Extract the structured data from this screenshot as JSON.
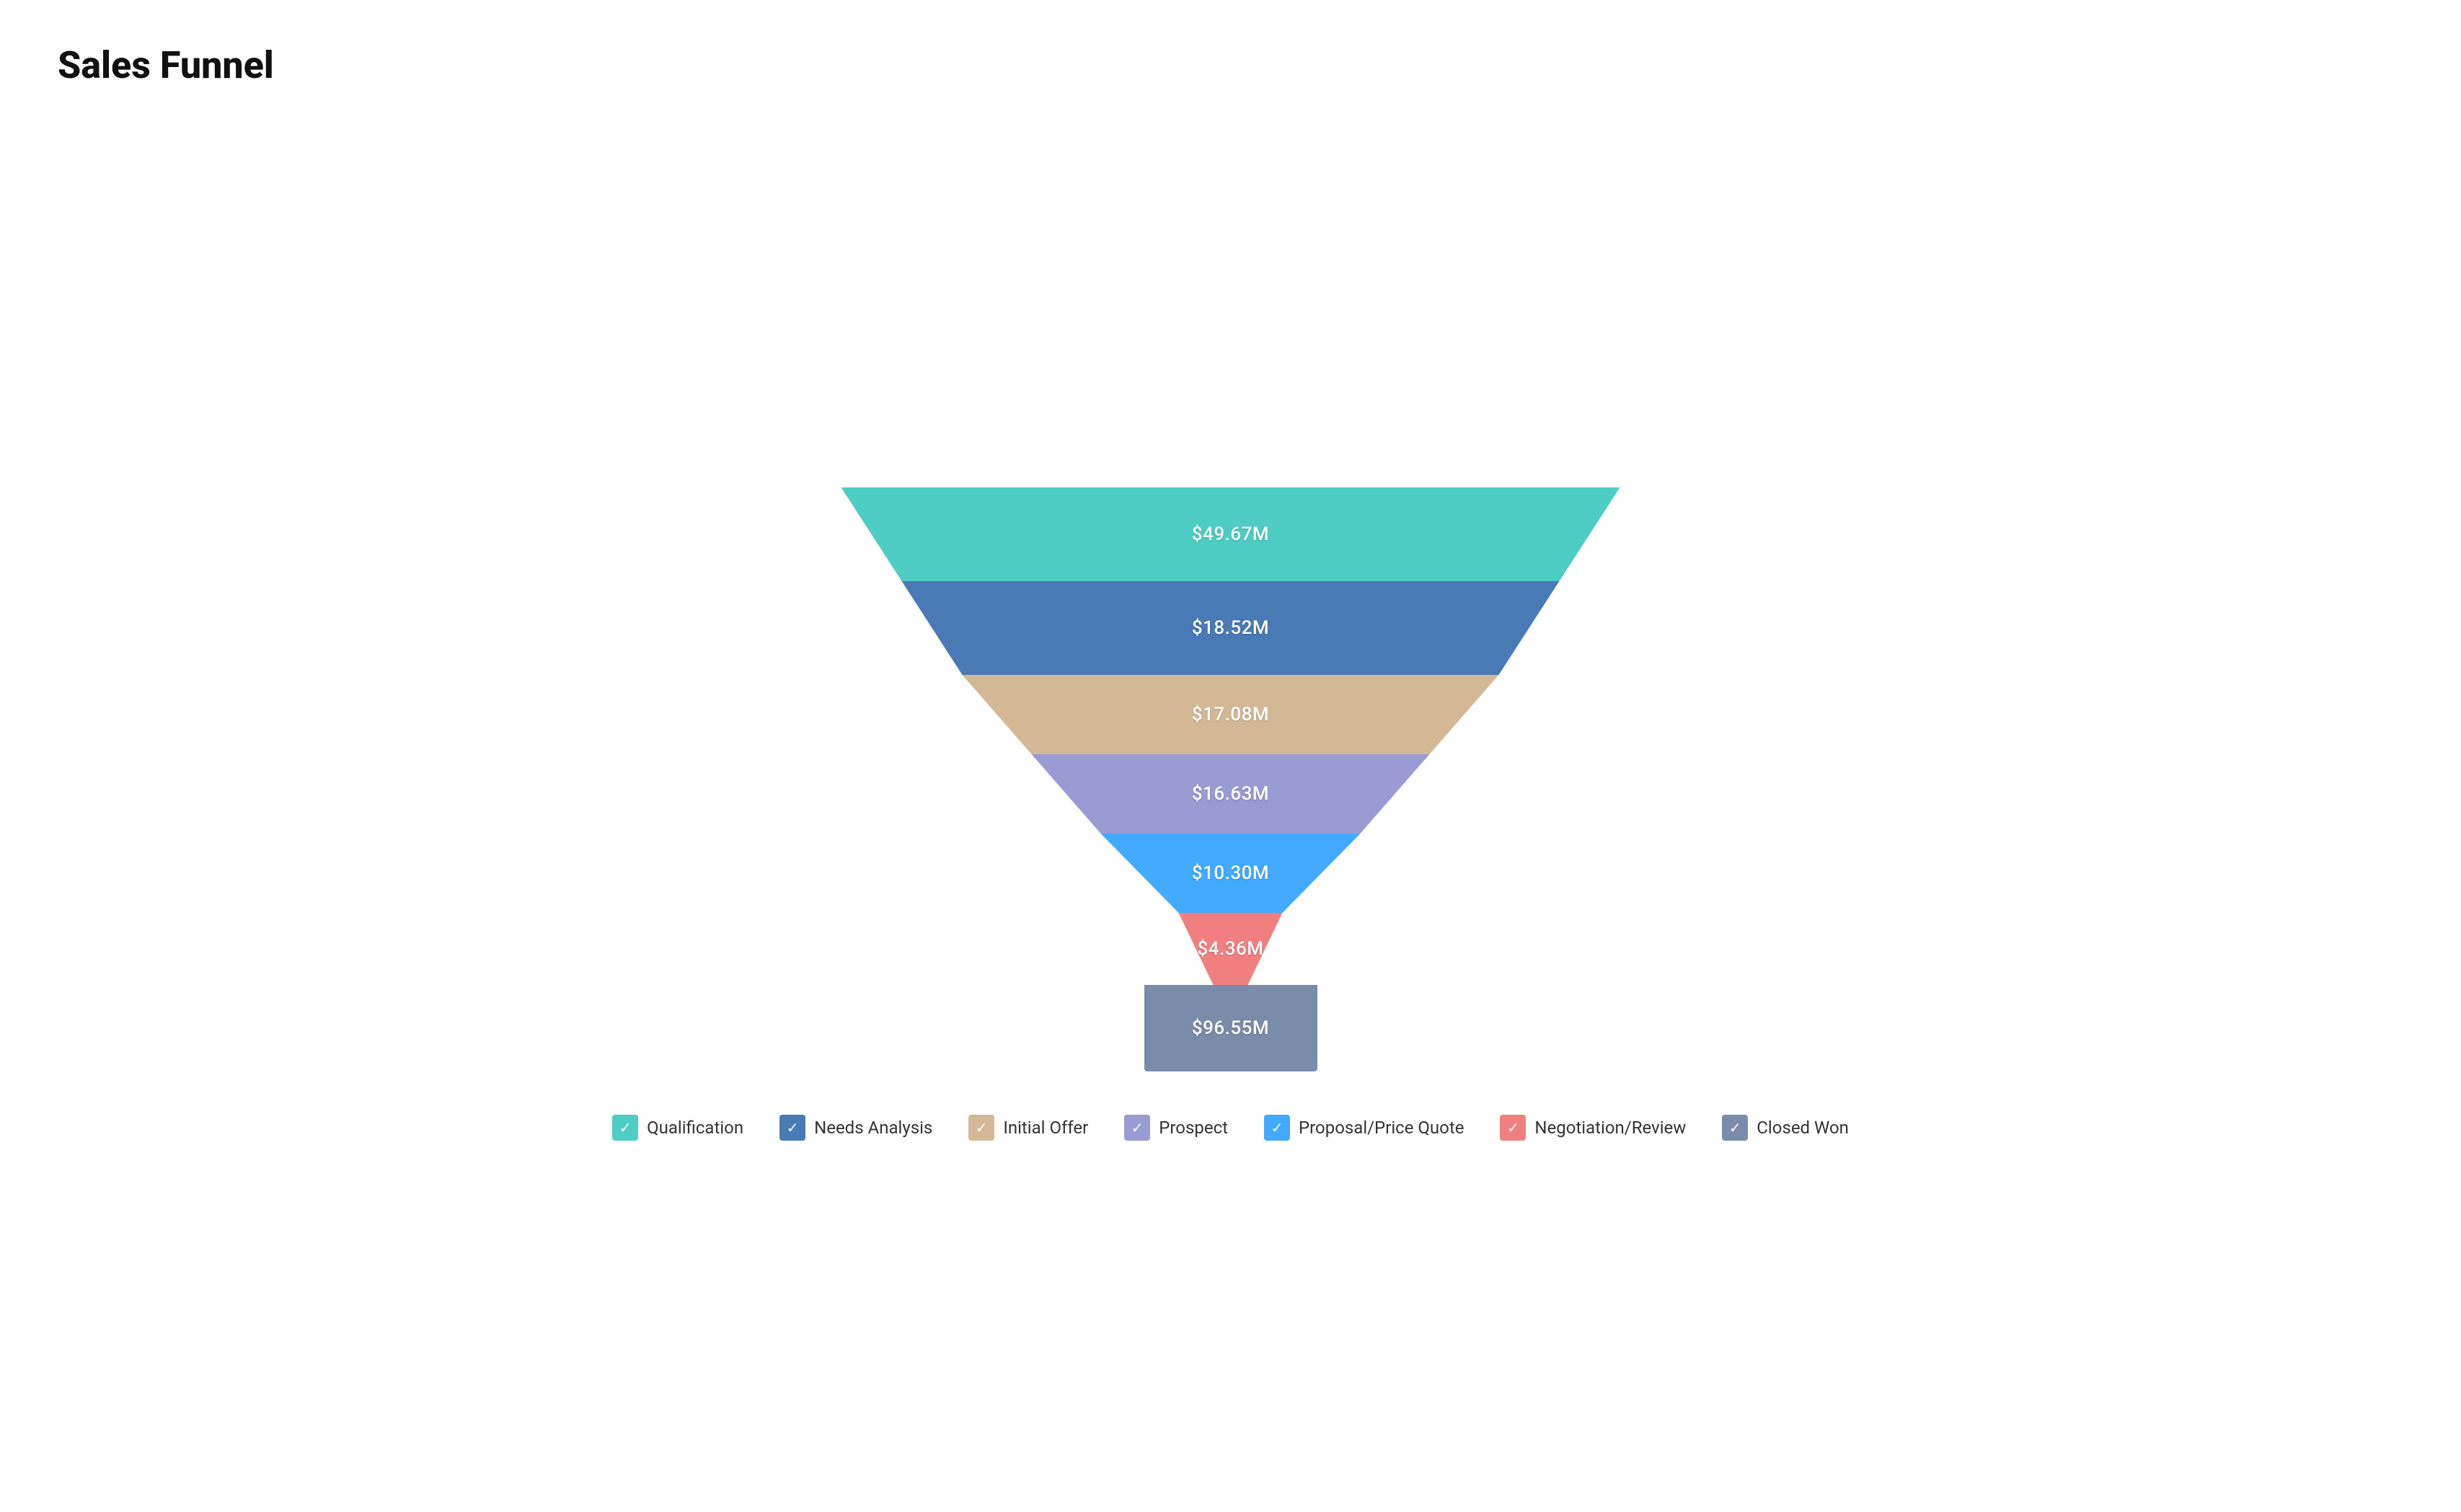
{
  "title": "Sales Funnel",
  "segments": [
    {
      "id": "qualification",
      "label": "$49.67M",
      "color": "#4ecdc4",
      "legend": "Qualification"
    },
    {
      "id": "needs-analysis",
      "label": "$18.52M",
      "color": "#4a7ab5",
      "legend": "Needs Analysis"
    },
    {
      "id": "initial-offer",
      "label": "$17.08M",
      "color": "#d4b896",
      "legend": "Initial Offer"
    },
    {
      "id": "prospect",
      "label": "$16.63M",
      "color": "#9b9bd4",
      "legend": "Prospect"
    },
    {
      "id": "proposal-price-quote",
      "label": "$10.30M",
      "color": "#42aaff",
      "legend": "Proposal/Price Quote"
    },
    {
      "id": "negotiation-review",
      "label": "$4.36M",
      "color": "#f08080",
      "legend": "Negotiation/Review"
    },
    {
      "id": "closed-won",
      "label": "$96.55M",
      "color": "#7b8caa",
      "legend": "Closed Won"
    }
  ]
}
